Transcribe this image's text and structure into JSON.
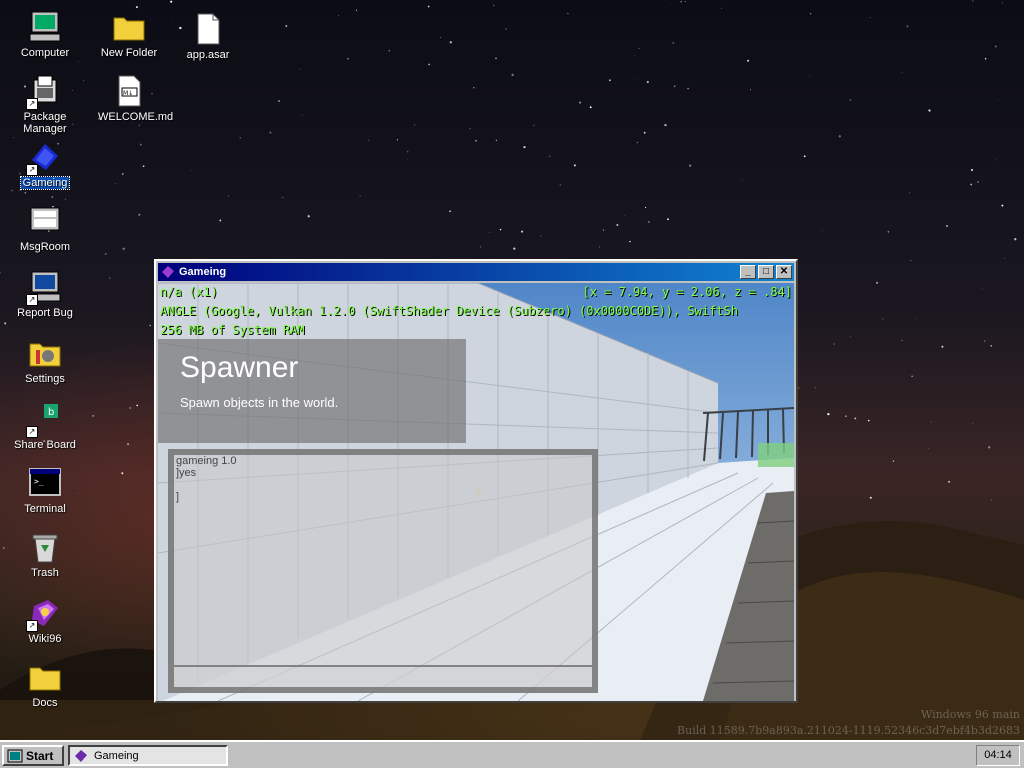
{
  "desktop": {
    "icons": [
      {
        "label": "Computer",
        "icon": "computer-icon"
      },
      {
        "label": "Package Manager",
        "icon": "package-manager-icon"
      },
      {
        "label": "Gameing",
        "icon": "gameing-icon"
      },
      {
        "label": "MsgRoom",
        "icon": "msgroom-icon"
      },
      {
        "label": "Report Bug",
        "icon": "report-bug-icon"
      },
      {
        "label": "Settings",
        "icon": "settings-icon"
      },
      {
        "label": "Share Board",
        "icon": "share-board-icon"
      },
      {
        "label": "Terminal",
        "icon": "terminal-icon"
      },
      {
        "label": "Trash",
        "icon": "trash-icon"
      },
      {
        "label": "Wiki96",
        "icon": "wiki-icon"
      },
      {
        "label": "Docs",
        "icon": "folder-icon"
      },
      {
        "label": "New Folder",
        "icon": "folder-icon"
      },
      {
        "label": "WELCOME.md",
        "icon": "markdown-file-icon"
      },
      {
        "label": "app.asar",
        "icon": "file-icon"
      }
    ],
    "selected_icon": "Gameing"
  },
  "window": {
    "title": "Gameing",
    "buttons": {
      "minimize": "_",
      "maximize": "□",
      "close": "✕"
    },
    "hud": {
      "renderer_prefix": "n/a (x1)",
      "coords": "[x = 7.94, y = 2.06, z = .84]",
      "gpu": "ANGLE (Google, Vulkan 1.2.0 (SwiftShader Device (Subzero) (0x0000C0DE)), SwiftSh",
      "memory": "256 MB of System RAM"
    },
    "spawner": {
      "heading": "Spawner",
      "subtitle": "Spawn objects in the world."
    },
    "console": {
      "lines": [
        "gameing 1.0",
        "]yes",
        "",
        "]"
      ]
    }
  },
  "watermark": {
    "line1": "Windows 96 main",
    "line2": "Build 11589.7b9a893a.211024-1119.52346c3d7ebf4b3d2683"
  },
  "taskbar": {
    "start_label": "Start",
    "task_label": "Gameing",
    "clock": "04:14"
  },
  "colors": {
    "titlebar_start": "#00007b",
    "titlebar_end": "#1084d0",
    "hud_text": "#7dff40",
    "selection": "#0a4fb4"
  }
}
